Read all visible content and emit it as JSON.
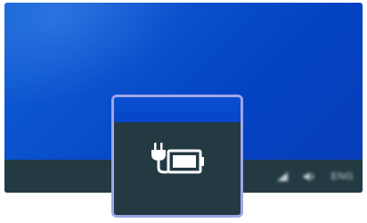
{
  "tray": {
    "language_label": "ENG",
    "icons": [
      "network-icon",
      "volume-icon"
    ]
  },
  "zoom_callout": {
    "icon": "battery-charging-icon"
  },
  "colors": {
    "desktop_blue": "#0a4fcc",
    "taskbar": "#233a43",
    "callout_border": "#9ea7e6",
    "icon_white": "#ffffff"
  }
}
